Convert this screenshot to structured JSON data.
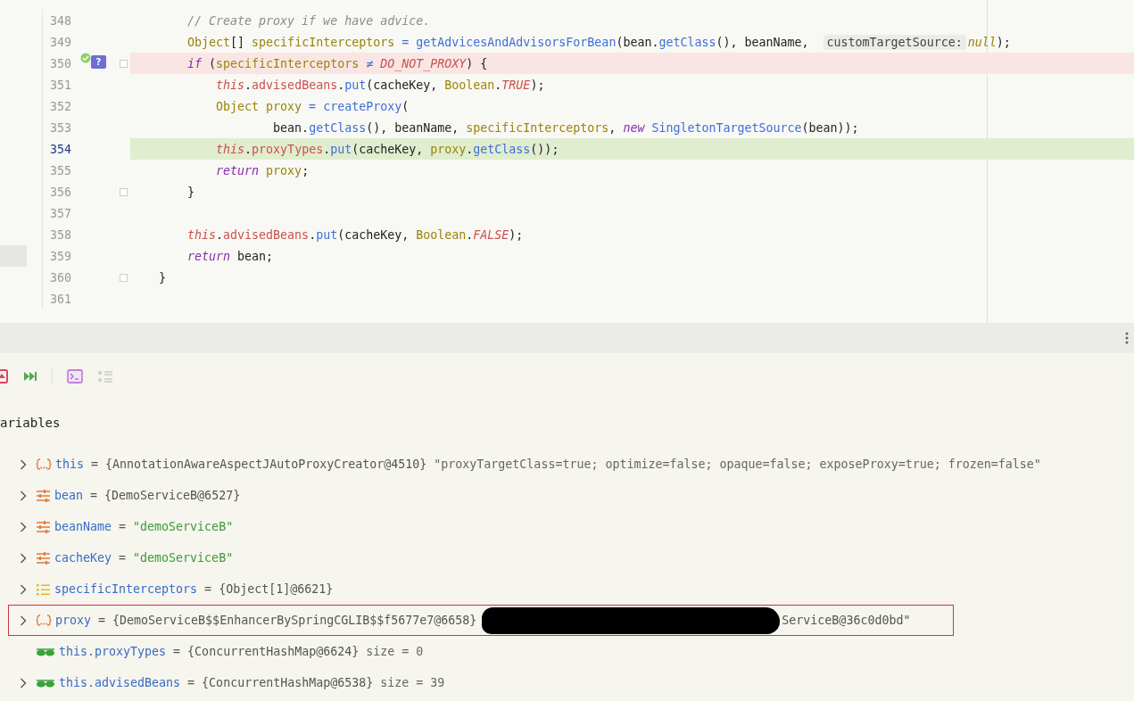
{
  "editor": {
    "lines": [
      {
        "number": "348",
        "breakpoint": false,
        "current": false,
        "fold": false,
        "tokens": [
          {
            "kind": "comment",
            "text": "    // Create proxy if we have advice."
          }
        ]
      },
      {
        "number": "349",
        "breakpoint": false,
        "current": false,
        "fold": false,
        "tokens": [
          {
            "kind": "type",
            "text": "    Object"
          },
          {
            "kind": "plain",
            "text": "[] "
          },
          {
            "kind": "local",
            "text": "specificInterceptors"
          },
          {
            "kind": "op",
            "text": " = "
          },
          {
            "kind": "method",
            "text": "getAdvicesAndAdvisorsForBean"
          },
          {
            "kind": "plain",
            "text": "(bean."
          },
          {
            "kind": "method",
            "text": "getClass"
          },
          {
            "kind": "plain",
            "text": "(), beanName, "
          },
          {
            "kind": "hint",
            "text": "customTargetSource:"
          },
          {
            "kind": "literal",
            "text": "null"
          },
          {
            "kind": "plain",
            "text": ");"
          }
        ]
      },
      {
        "number": "350",
        "breakpoint": true,
        "current": false,
        "fold": true,
        "gutter_badge": "?",
        "tokens": [
          {
            "kind": "keyword",
            "text": "    if"
          },
          {
            "kind": "plain",
            "text": " ("
          },
          {
            "kind": "local",
            "text": "specificInterceptors"
          },
          {
            "kind": "op",
            "text": " ≠ "
          },
          {
            "kind": "constant",
            "text": "DO_NOT_PROXY"
          },
          {
            "kind": "plain",
            "text": ") {"
          }
        ]
      },
      {
        "number": "351",
        "breakpoint": false,
        "current": false,
        "fold": false,
        "tokens": [
          {
            "kind": "self",
            "text": "        this"
          },
          {
            "kind": "plain",
            "text": "."
          },
          {
            "kind": "field",
            "text": "advisedBeans"
          },
          {
            "kind": "plain",
            "text": "."
          },
          {
            "kind": "method",
            "text": "put"
          },
          {
            "kind": "plain",
            "text": "(cacheKey, "
          },
          {
            "kind": "type",
            "text": "Boolean"
          },
          {
            "kind": "plain",
            "text": "."
          },
          {
            "kind": "constant",
            "text": "TRUE"
          },
          {
            "kind": "plain",
            "text": ");"
          }
        ]
      },
      {
        "number": "352",
        "breakpoint": false,
        "current": false,
        "fold": false,
        "tokens": [
          {
            "kind": "type",
            "text": "        Object proxy"
          },
          {
            "kind": "op",
            "text": " = "
          },
          {
            "kind": "method",
            "text": "createProxy"
          },
          {
            "kind": "plain",
            "text": "("
          }
        ]
      },
      {
        "number": "353",
        "breakpoint": false,
        "current": false,
        "fold": false,
        "tokens": [
          {
            "kind": "plain",
            "text": "                bean."
          },
          {
            "kind": "method",
            "text": "getClass"
          },
          {
            "kind": "plain",
            "text": "(), beanName, "
          },
          {
            "kind": "local",
            "text": "specificInterceptors"
          },
          {
            "kind": "plain",
            "text": ", "
          },
          {
            "kind": "keyword",
            "text": "new"
          },
          {
            "kind": "method",
            "text": " SingletonTargetSource"
          },
          {
            "kind": "plain",
            "text": "(bean));"
          }
        ]
      },
      {
        "number": "354",
        "breakpoint": false,
        "current": true,
        "fold": false,
        "tokens": [
          {
            "kind": "self",
            "text": "        this"
          },
          {
            "kind": "plain",
            "text": "."
          },
          {
            "kind": "field",
            "text": "proxyTypes"
          },
          {
            "kind": "plain",
            "text": "."
          },
          {
            "kind": "method",
            "text": "put"
          },
          {
            "kind": "plain",
            "text": "(cacheKey, "
          },
          {
            "kind": "local",
            "text": "proxy"
          },
          {
            "kind": "plain",
            "text": "."
          },
          {
            "kind": "method",
            "text": "getClass"
          },
          {
            "kind": "plain",
            "text": "());"
          }
        ]
      },
      {
        "number": "355",
        "breakpoint": false,
        "current": false,
        "fold": false,
        "tokens": [
          {
            "kind": "keyword",
            "text": "        return"
          },
          {
            "kind": "local",
            "text": " proxy"
          },
          {
            "kind": "plain",
            "text": ";"
          }
        ]
      },
      {
        "number": "356",
        "breakpoint": false,
        "current": false,
        "fold": true,
        "tokens": [
          {
            "kind": "plain",
            "text": "    }"
          }
        ]
      },
      {
        "number": "357",
        "breakpoint": false,
        "current": false,
        "fold": false
      },
      {
        "number": "358",
        "breakpoint": false,
        "current": false,
        "fold": false,
        "tokens": [
          {
            "kind": "self",
            "text": "    this"
          },
          {
            "kind": "plain",
            "text": "."
          },
          {
            "kind": "field",
            "text": "advisedBeans"
          },
          {
            "kind": "plain",
            "text": "."
          },
          {
            "kind": "method",
            "text": "put"
          },
          {
            "kind": "plain",
            "text": "(cacheKey, "
          },
          {
            "kind": "type",
            "text": "Boolean"
          },
          {
            "kind": "plain",
            "text": "."
          },
          {
            "kind": "constant",
            "text": "FALSE"
          },
          {
            "kind": "plain",
            "text": ");"
          }
        ]
      },
      {
        "number": "359",
        "breakpoint": false,
        "current": false,
        "fold": false,
        "tokens": [
          {
            "kind": "keyword",
            "text": "    return"
          },
          {
            "kind": "plain",
            "text": " bean;"
          }
        ]
      },
      {
        "number": "360",
        "breakpoint": false,
        "current": false,
        "fold": true,
        "tokens": [
          {
            "kind": "plain",
            "text": "}"
          }
        ]
      },
      {
        "number": "361",
        "breakpoint": false,
        "current": false,
        "fold": false
      }
    ]
  },
  "variables": {
    "title": "ariables",
    "rows": [
      {
        "expandable": true,
        "kind": "object",
        "name": "this",
        "operator": "=",
        "value": "{AnnotationAwareAspectJAutoProxyCreator@4510}",
        "is_string": false,
        "extra": "\"proxyTargetClass=true; optimize=false; opaque=false; exposeProxy=true; frozen=false\"",
        "highlighted": false
      },
      {
        "expandable": true,
        "kind": "field",
        "name": "bean",
        "operator": "=",
        "value": "{DemoServiceB@6527}",
        "is_string": false,
        "highlighted": false
      },
      {
        "expandable": true,
        "kind": "field",
        "name": "beanName",
        "operator": "=",
        "value": "\"demoServiceB\"",
        "is_string": true,
        "highlighted": false
      },
      {
        "expandable": true,
        "kind": "field",
        "name": "cacheKey",
        "operator": "=",
        "value": "\"demoServiceB\"",
        "is_string": true,
        "highlighted": false
      },
      {
        "expandable": true,
        "kind": "array",
        "name": "specificInterceptors",
        "operator": "=",
        "value": "{Object[1]@6621}",
        "is_string": false,
        "highlighted": false
      },
      {
        "expandable": true,
        "kind": "object",
        "name": "proxy",
        "operator": "=",
        "value": "{DemoServiceB$$EnhancerBySpringCGLIB$$f5677e7@6658}",
        "is_string": false,
        "redacted": true,
        "extra": "ServiceB@36c0d0bd\"",
        "highlighted": true
      },
      {
        "expandable": false,
        "kind": "watch",
        "name": "this.proxyTypes",
        "operator": "=",
        "value": "{ConcurrentHashMap@6624}",
        "is_string": false,
        "extra": "size = 0",
        "highlighted": false
      },
      {
        "expandable": true,
        "kind": "watch",
        "name": "this.advisedBeans",
        "operator": "=",
        "value": "{ConcurrentHashMap@6538}",
        "is_string": false,
        "extra": "size = 39",
        "highlighted": false
      }
    ]
  }
}
